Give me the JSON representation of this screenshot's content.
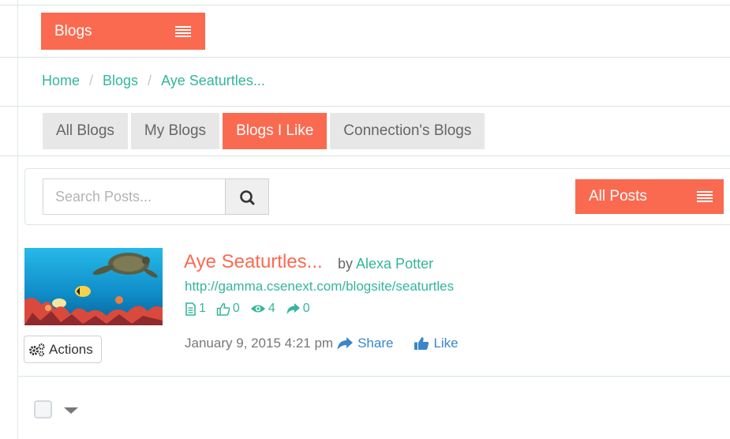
{
  "header": {
    "blogs_button_label": "Blogs",
    "menu_icon": "hamburger-menu-icon"
  },
  "breadcrumb": {
    "items": [
      "Home",
      "Blogs",
      "Aye Seaturtles..."
    ],
    "separator": "/"
  },
  "tabs": [
    {
      "label": "All Blogs",
      "active": false
    },
    {
      "label": "My Blogs",
      "active": false
    },
    {
      "label": "Blogs I Like",
      "active": true
    },
    {
      "label": "Connection's Blogs",
      "active": false
    }
  ],
  "search": {
    "placeholder": "Search Posts...",
    "value": "",
    "icon": "magnifier-icon"
  },
  "filter": {
    "all_posts_label": "All Posts"
  },
  "post": {
    "title": "Aye Seaturtles...",
    "by_label": "by",
    "author": "Alexa Potter",
    "url": "http://gamma.csenext.com/blogsite/seaturtles",
    "stats": {
      "posts": "1",
      "likes": "0",
      "views": "4",
      "shares": "0"
    },
    "date": "January 9, 2015 4:21 pm",
    "share_label": "Share",
    "like_label": "Like",
    "actions_label": "Actions",
    "thumbnail": "sea-turtle-coral-reef-image"
  },
  "colors": {
    "accent": "#fa6a50",
    "link": "#35b59c",
    "action_blue": "#3a86c8",
    "tab_bg": "#e7e7e7"
  }
}
